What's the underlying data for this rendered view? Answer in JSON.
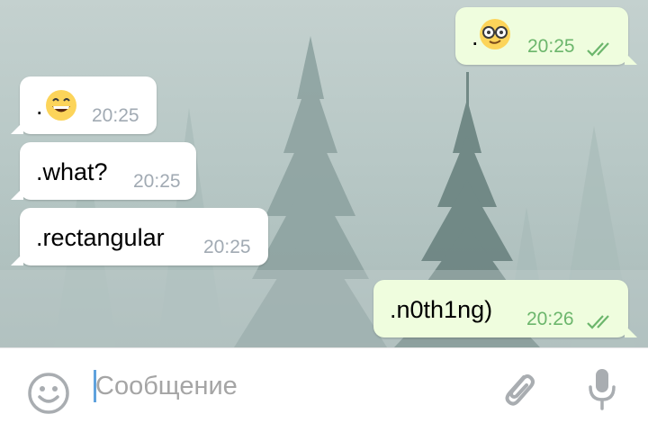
{
  "chat": {
    "messages": [
      {
        "direction": "outgoing",
        "text": ".",
        "emoji": "nerd-face-icon",
        "time": "20:25",
        "status": "read"
      },
      {
        "direction": "incoming",
        "text": ".",
        "emoji": "grinning-face-icon",
        "time": "20:25"
      },
      {
        "direction": "incoming",
        "text": ".what?",
        "time": "20:25"
      },
      {
        "direction": "incoming",
        "text": ".rectangular",
        "time": "20:25"
      },
      {
        "direction": "outgoing",
        "text": ".n0th1ng)",
        "time": "20:26",
        "status": "read"
      }
    ]
  },
  "composer": {
    "placeholder": "Сообщение",
    "value": "",
    "icons": [
      "smile-icon",
      "paperclip-icon",
      "microphone-icon"
    ]
  },
  "colors": {
    "outgoing_bubble": "#effdde",
    "incoming_bubble": "#ffffff",
    "outgoing_time": "#6cb66c",
    "incoming_time": "#a1aab3",
    "caret": "#5fa2dd",
    "icon_gray": "#a9adb1"
  }
}
